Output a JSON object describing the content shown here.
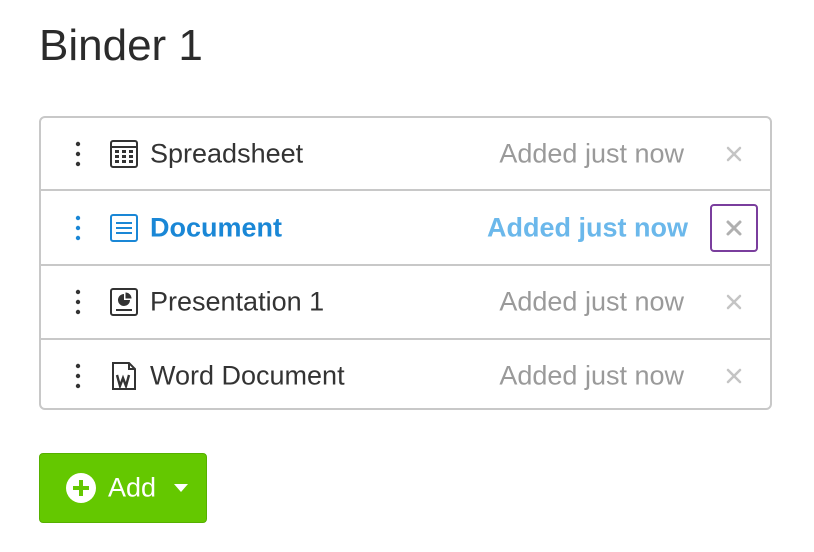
{
  "binder": {
    "title": "Binder 1"
  },
  "items": [
    {
      "name": "Spreadsheet",
      "added": "Added just now",
      "icon": "spreadsheet-icon",
      "active": false
    },
    {
      "name": "Document",
      "added": "Added just now",
      "icon": "document-icon",
      "active": true
    },
    {
      "name": "Presentation 1",
      "added": "Added just now",
      "icon": "presentation-icon",
      "active": false
    },
    {
      "name": "Word Document",
      "added": "Added just now",
      "icon": "word-document-icon",
      "active": false
    }
  ],
  "add_button": {
    "label": "Add",
    "icon": "plus-circle-icon",
    "dropdown_icon": "caret-down-icon"
  },
  "colors": {
    "accent_blue": "#1a87d6",
    "accent_blue_light": "#6bb8eb",
    "focus_outline": "#7a3e9d",
    "add_green": "#64c800",
    "muted_text": "#9a9a9a",
    "border": "#c8c8c8"
  }
}
